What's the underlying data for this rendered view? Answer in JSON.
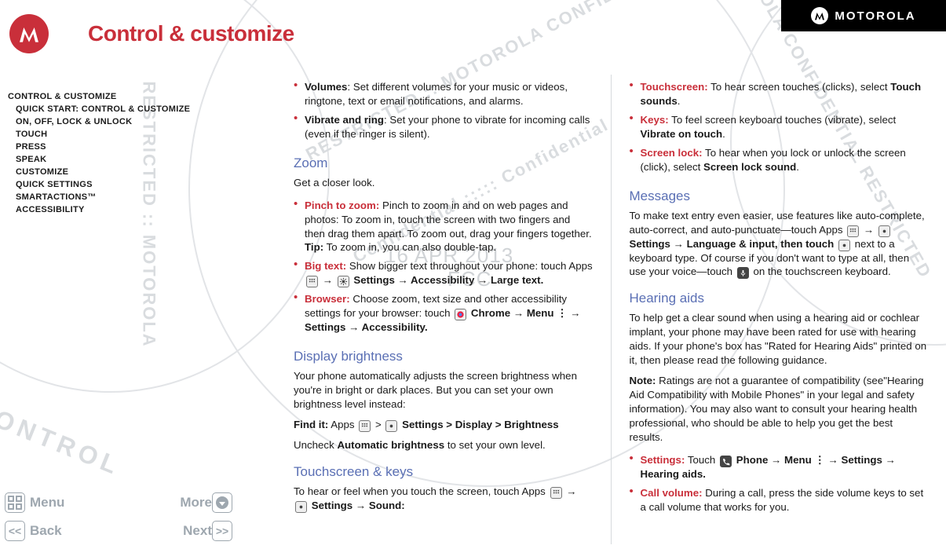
{
  "brand": "MOTOROLA",
  "page_title": "Control & customize",
  "watermark_date": "16 APR 2013",
  "watermark_fcc": "FCC",
  "sidebar": [
    "Control & customize",
    "Quick start: Control & customize",
    "On, off, lock & unlock",
    "Touch",
    "Press",
    "Speak",
    "Customize",
    "Quick settings",
    "SMARTACTIONS™",
    "Accessibility"
  ],
  "bottom_nav": {
    "menu": "Menu",
    "more": "More",
    "back": "Back",
    "next": "Next"
  },
  "col1": {
    "volumes_label": "Volumes",
    "volumes_text": ": Set different volumes for your music or videos, ringtone, text or email notifications, and alarms.",
    "vibrate_label": "Vibrate and ring",
    "vibrate_text": ": Set your phone to vibrate for incoming calls (even if the ringer is silent).",
    "zoom_h": "Zoom",
    "zoom_intro": "Get a closer look.",
    "pinch_label": "Pinch to zoom:",
    "pinch_text": " Pinch to zoom in and on web pages and photos: To zoom in, touch the screen with two fingers and then drag them apart. To zoom out, drag your fingers together.",
    "tip_label": "Tip:",
    "tip_text": " To zoom in, you can also double-tap.",
    "bigtext_label": "Big text:",
    "bigtext_text": " Show bigger text throughout your phone: touch Apps ",
    "bigtext_tail": " Settings → Accessibility → Large text.",
    "browser_label": "Browser:",
    "browser_text": " Choose zoom, text size and other accessibility settings for your browser: touch ",
    "browser_tail1": " Chrome → Menu ",
    "browser_tail2": " → Settings → Accessibility.",
    "display_h": "Display brightness",
    "display_p": "Your phone automatically adjusts the screen brightness when you're in bright or dark places. But you can set your own brightness level instead:",
    "findit": "Find it:",
    "findit_tail": " Apps ",
    "findit_path": "Settings > Display > Brightness",
    "uncheck_a": "Uncheck ",
    "uncheck_b": "Automatic brightness",
    "uncheck_c": " to set your own level.",
    "touch_h": "Touchscreen & keys",
    "touch_p_a": "To hear or feel when you touch the screen, touch Apps ",
    "touch_p_b": " Settings → Sound:"
  },
  "col2": {
    "ts_label": "Touchscreen:",
    "ts_text": " To hear screen touches (clicks), select ",
    "ts_b": "Touch sounds",
    "keys_label": "Keys:",
    "keys_text": " To feel screen keyboard touches (vibrate), select ",
    "keys_b": "Vibrate on touch",
    "lock_label": "Screen lock:",
    "lock_text": " To hear when you lock or unlock the screen (click), select ",
    "lock_b": "Screen lock sound",
    "msg_h": "Messages",
    "msg_p1": "To make text entry even easier, use features like auto-complete, auto-correct, and auto-punctuate—touch Apps ",
    "msg_p2": " Settings → Language & input, then touch ",
    "msg_p3": " next to a keyboard type. Of course if you don't want to type at all, then use your voice—touch ",
    "msg_p4": " on the touchscreen keyboard.",
    "ha_h": "Hearing aids",
    "ha_p": "To help get a clear sound when using a hearing aid or cochlear implant, your phone may have been rated for use with hearing aids. If your phone's box has \"Rated for Hearing Aids\" printed on it, then please read the following guidance.",
    "note_label": "Note:",
    "note_text": " Ratings are not a guarantee of compatibility (see\"Hearing Aid Compatibility with Mobile Phones\" in your legal and safety information). You may also want to consult your hearing health professional, who should be able to help you get the best results.",
    "set_label": "Settings:",
    "set_text": " Touch ",
    "set_path": " Phone → Menu ",
    "set_tail": " → Settings → Hearing aids.",
    "cv_label": "Call volume:",
    "cv_text": " During a call, press the side volume keys to set a call volume that works for you."
  }
}
